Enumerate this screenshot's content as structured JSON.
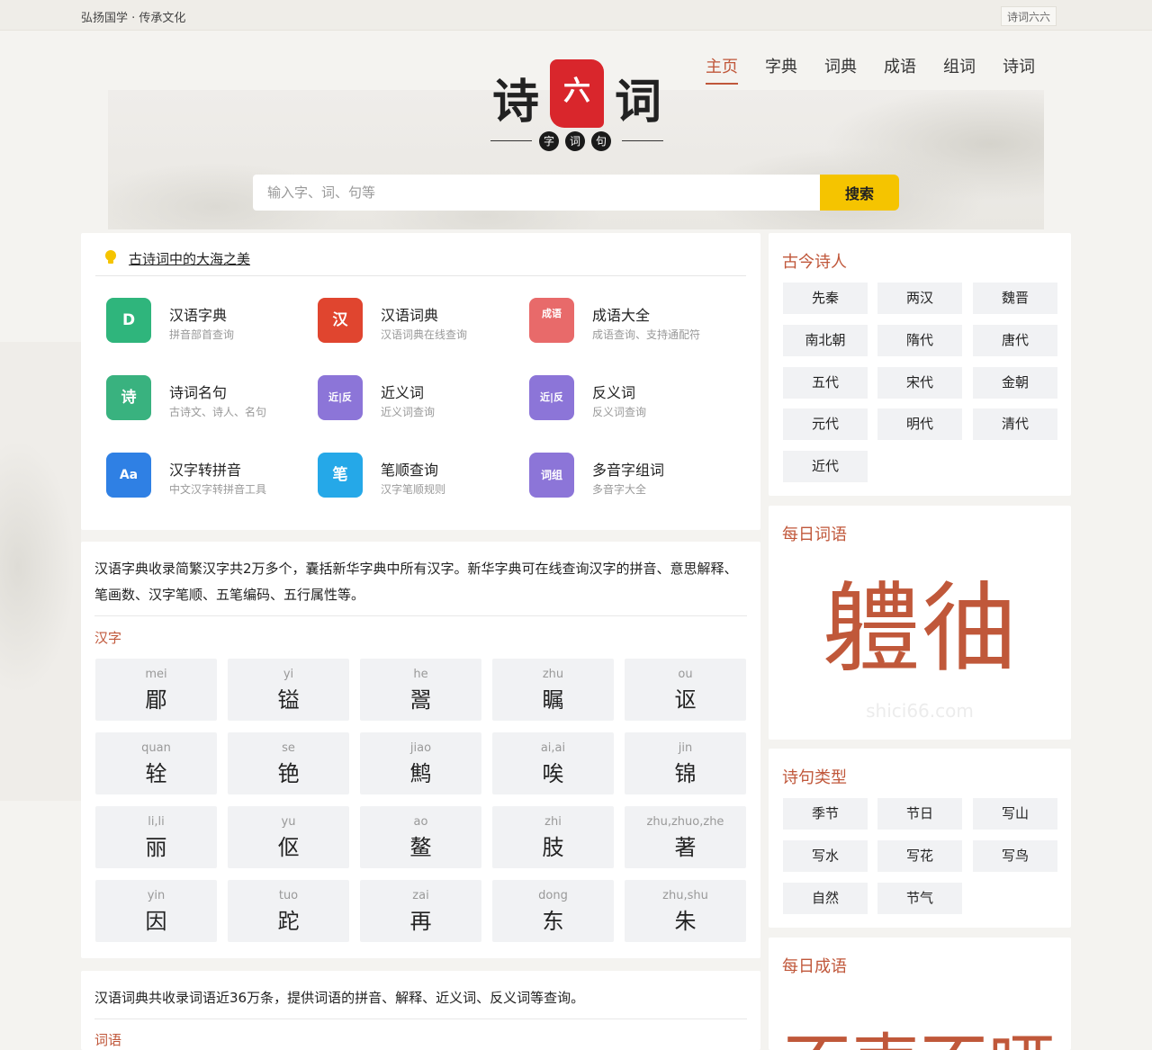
{
  "topbar": {
    "slogan": "弘扬国学 · 传承文化",
    "brand": "诗词六六"
  },
  "logo": {
    "left": "诗",
    "seal": "六",
    "right": "词",
    "dots": [
      "字",
      "词",
      "句"
    ]
  },
  "nav": [
    "主页",
    "字典",
    "词典",
    "成语",
    "组词",
    "诗词"
  ],
  "search": {
    "placeholder": "输入字、词、句等",
    "button": "搜索"
  },
  "notice": {
    "text": "古诗词中的大海之美"
  },
  "tools": [
    {
      "name": "汉语字典",
      "desc": "拼音部首查询",
      "icon": "D",
      "color": "#2fb57c"
    },
    {
      "name": "汉语词典",
      "desc": "汉语词典在线查询",
      "icon": "汉",
      "color": "#e0452f"
    },
    {
      "name": "成语大全",
      "desc": "成语查询、支持通配符",
      "icon": "成语",
      "color": "#e86a6a"
    },
    {
      "name": "诗词名句",
      "desc": "古诗文、诗人、名句",
      "icon": "诗",
      "color": "#39b27f"
    },
    {
      "name": "近义词",
      "desc": "近义词查询",
      "icon": "近|反",
      "color": "#8c75d8"
    },
    {
      "name": "反义词",
      "desc": "反义词查询",
      "icon": "近|反",
      "color": "#8c75d8"
    },
    {
      "name": "汉字转拼音",
      "desc": "中文汉字转拼音工具",
      "icon": "Aa",
      "color": "#2f80e4"
    },
    {
      "name": "笔顺查询",
      "desc": "汉字笔顺规则",
      "icon": "笔",
      "color": "#25a8e8"
    },
    {
      "name": "多音字组词",
      "desc": "多音字大全",
      "icon": "词组",
      "color": "#8c75d8"
    }
  ],
  "hanzi": {
    "intro": "汉语字典收录简繁汉字共2万多个，囊括新华字典中所有汉字。新华字典可在线查询汉字的拼音、意思解释、笔画数、汉字笔顺、五笔编码、五行属性等。",
    "title": "汉字",
    "chars": [
      {
        "py": "mei",
        "zi": "郿"
      },
      {
        "py": "yi",
        "zi": "镒"
      },
      {
        "py": "he",
        "zi": "翯"
      },
      {
        "py": "zhu",
        "zi": "瞩"
      },
      {
        "py": "ou",
        "zi": "讴"
      },
      {
        "py": "quan",
        "zi": "辁"
      },
      {
        "py": "se",
        "zi": "铯"
      },
      {
        "py": "jiao",
        "zi": "鹪"
      },
      {
        "py": "ai,ai",
        "zi": "唉"
      },
      {
        "py": "jin",
        "zi": "锦"
      },
      {
        "py": "li,li",
        "zi": "丽"
      },
      {
        "py": "yu",
        "zi": "伛"
      },
      {
        "py": "ao",
        "zi": "鳌"
      },
      {
        "py": "zhi",
        "zi": "肢"
      },
      {
        "py": "zhu,zhuo,zhe",
        "zi": "著"
      },
      {
        "py": "yin",
        "zi": "因"
      },
      {
        "py": "tuo",
        "zi": "跎"
      },
      {
        "py": "zai",
        "zi": "再"
      },
      {
        "py": "dong",
        "zi": "东"
      },
      {
        "py": "zhu,shu",
        "zi": "朱"
      }
    ]
  },
  "ciyu": {
    "intro": "汉语词典共收录词语近36万条，提供词语的拼音、解释、近义词、反义词等查询。",
    "title": "词语"
  },
  "poets": {
    "title": "古今诗人",
    "items": [
      "先秦",
      "两汉",
      "魏晋",
      "南北朝",
      "隋代",
      "唐代",
      "五代",
      "宋代",
      "金朝",
      "元代",
      "明代",
      "清代",
      "近代"
    ]
  },
  "daily_word": {
    "title": "每日词语",
    "word": "軆㣙",
    "watermark": "shici66.com"
  },
  "poem_types": {
    "title": "诗句类型",
    "items": [
      "季节",
      "节日",
      "写山",
      "写水",
      "写花",
      "写鸟",
      "自然",
      "节气"
    ]
  },
  "daily_idiom": {
    "title": "每日成语",
    "word": "不声不哑"
  }
}
